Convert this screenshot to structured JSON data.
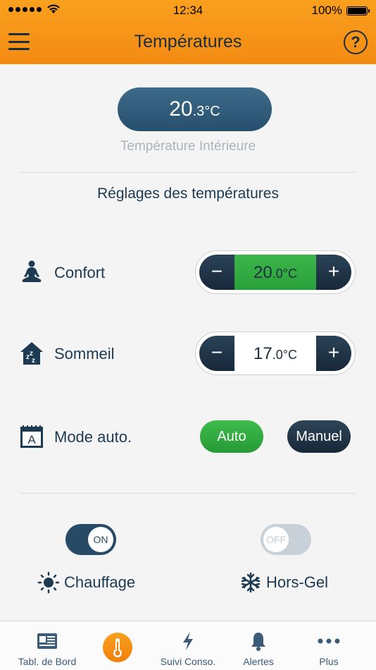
{
  "status_bar": {
    "time": "12:34",
    "battery": "100%"
  },
  "header": {
    "title": "Températures",
    "help_label": "?"
  },
  "indoor": {
    "value_big": "20",
    "value_small": ".3°C",
    "label": "Température Intérieure"
  },
  "settings": {
    "section_title": "Réglages des températures",
    "confort": {
      "label": "Confort",
      "value_big": "20",
      "value_small": ".0°C",
      "minus": "−",
      "plus": "+"
    },
    "sommeil": {
      "label": "Sommeil",
      "value_big": "17",
      "value_small": ".0°C",
      "minus": "−",
      "plus": "+"
    },
    "mode": {
      "label": "Mode auto.",
      "auto_label": "Auto",
      "manual_label": "Manuel",
      "icon_letter": "A"
    }
  },
  "toggles": {
    "chauffage": {
      "state": "ON",
      "label": "Chauffage"
    },
    "hors_gel": {
      "state": "OFF",
      "label": "Hors-Gel"
    }
  },
  "tabs": [
    {
      "label": "Tabl. de Bord",
      "icon": "dashboard-icon"
    },
    {
      "label": "",
      "icon": "thermometer-icon",
      "active": true
    },
    {
      "label": "Suivi Conso.",
      "icon": "lightning-icon"
    },
    {
      "label": "Alertes",
      "icon": "bell-icon"
    },
    {
      "label": "Plus",
      "icon": "more-icon"
    }
  ],
  "colors": {
    "header": "#f38a12",
    "navy": "#274a66",
    "green": "#2aa03a"
  }
}
